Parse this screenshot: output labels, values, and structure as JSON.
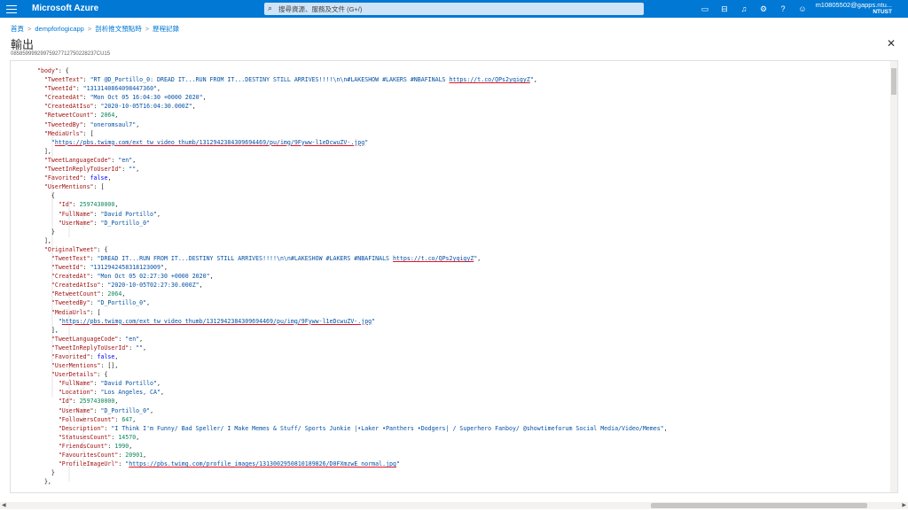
{
  "topbar": {
    "brand": "Microsoft Azure",
    "search_placeholder": "搜尋資源、服務及文件 (G+/)",
    "icons": [
      "cloud-shell-icon",
      "directory-filter-icon",
      "notifications-icon",
      "settings-icon",
      "help-icon",
      "feedback-icon"
    ],
    "account_email": "m10805502@gapps.ntu...",
    "account_org": "NTUST"
  },
  "breadcrumb": [
    "首頁",
    "dempforlogicapp",
    "剖析推文預點時",
    "歷程記錄"
  ],
  "page": {
    "title": "輸出",
    "run_id": "08585999929975927712750228237CU15"
  },
  "code": {
    "body_key": "\"body\"",
    "tweet": {
      "TweetText": "\"RT @D_Portillo_0: DREAD IT...RUN FROM IT...DESTINY STILL ARRIVES!!!!\\n\\n#LAKESHOW #LAKERS #NBAFINALS",
      "TweetText_url": "https://t.co/QPs2yqigyZ",
      "TweetId": "\"1313140864098447360\"",
      "CreatedAt": "\"Mon Oct 05 16:04:30 +0000 2020\"",
      "CreatedAtIso": "\"2020-10-05T16:04:30.000Z\"",
      "RetweetCount": "2064",
      "TweetedBy": "\"oneromsaul7\"",
      "MediaUrl": "https://pbs.twimg.com/ext_tw_video_thumb/1312942384309694469/pu/img/9Fyww-l1eDcwuZV-.jpg",
      "TweetLanguageCode": "\"en\"",
      "TweetInReplyToUserId": "\"\"",
      "Favorited": "false",
      "Mention_Id": "2597430000",
      "Mention_FullName": "\"David Portillo\"",
      "Mention_UserName": "\"D_Portillo_0\""
    },
    "original": {
      "TweetText": "\"DREAD IT...RUN FROM IT...DESTINY STILL ARRIVES!!!!\\n\\n#LAKESHOW #LAKERS #NBAFINALS",
      "TweetText_url": "https://t.co/QPs2yqigyZ",
      "TweetId": "\"1312942458318123009\"",
      "CreatedAt": "\"Mon Oct 05 02:27:30 +0000 2020\"",
      "CreatedAtIso": "\"2020-10-05T02:27:30.000Z\"",
      "RetweetCount": "2064",
      "TweetedBy": "\"D_Portillo_0\"",
      "MediaUrl": "https://pbs.twimg.com/ext_tw_video_thumb/1312942384309694469/pu/img/9Fyww-l1eDcwuZV-.jpg",
      "TweetLanguageCode": "\"en\"",
      "TweetInReplyToUserId": "\"\"",
      "Favorited": "false",
      "UserMentions": "[]",
      "UD_FullName": "\"David Portillo\"",
      "UD_Location": "\"Los Angeles, CA\"",
      "UD_Id": "2597430000",
      "UD_UserName": "\"D_Portillo_0\"",
      "UD_FollowersCount": "647",
      "UD_Description": "\"I Think I'm Funny/ Bad Speller/ I Make Memes & Stuff/ Sports Junkie |•Laker •Panthers •Dodgers| / Superhero Fanboy/ @showtimeforum Social Media/Video/Memes\"",
      "UD_StatusesCount": "14570",
      "UD_FriendsCount": "1990",
      "UD_FavouritesCount": "20901",
      "UD_ProfileImageUrl": "https://pbs.twimg.com/profile_images/1313002950810189826/D0FXmzwE_normal.jpg"
    }
  }
}
